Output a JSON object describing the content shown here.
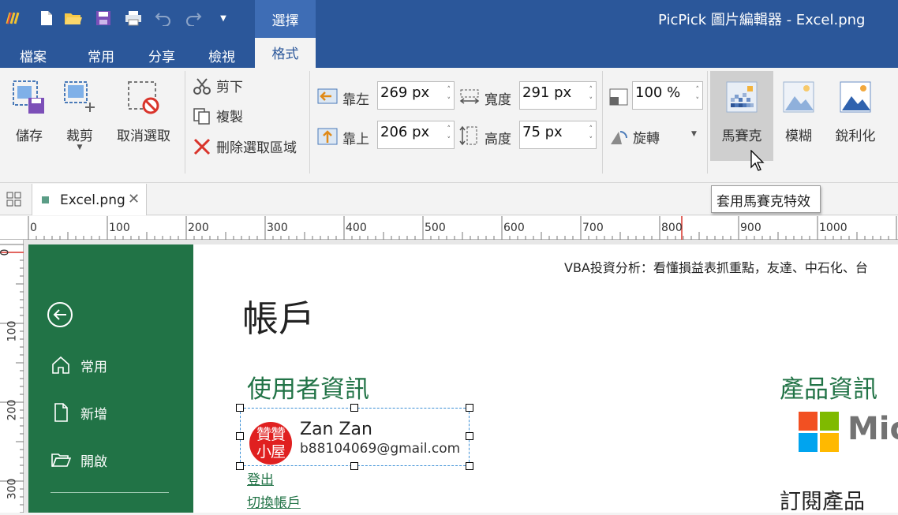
{
  "titlebar": {
    "app_title": "PicPick 圖片編輯器 - Excel.png",
    "context_tab": "選擇",
    "quick_access": [
      "logo-icon",
      "new-file-icon",
      "open-folder-icon",
      "save-icon",
      "print-icon",
      "undo-icon",
      "redo-icon",
      "customize-dropdown-icon"
    ]
  },
  "tabs": [
    {
      "label": "檔案"
    },
    {
      "label": "常用"
    },
    {
      "label": "分享"
    },
    {
      "label": "檢視"
    },
    {
      "label": "格式",
      "active": true
    }
  ],
  "ribbon": {
    "save": "儲存",
    "crop": "裁剪",
    "deselect": "取消選取",
    "cut": "剪下",
    "copy": "複製",
    "delete_selection": "刪除選取區域",
    "left_label": "靠左",
    "left_value": "269 px",
    "top_label": "靠上",
    "top_value": "206 px",
    "width_label": "寬度",
    "width_value": "291 px",
    "height_label": "高度",
    "height_value": "75 px",
    "zoom_value": "100 %",
    "rotate": "旋轉",
    "mosaic": "馬賽克",
    "blur": "模糊",
    "sharpen": "銳利化"
  },
  "tooltip": "套用馬賽克特效",
  "doc_tab": {
    "name": "Excel.png"
  },
  "ruler": {
    "h_ticks": [
      "0",
      "100",
      "200",
      "300",
      "400",
      "500",
      "600",
      "700",
      "800",
      "900",
      "1000"
    ],
    "v_ticks": [
      "0",
      "100",
      "200",
      "300"
    ]
  },
  "image": {
    "top_banner": "VBA投資分析：看懂損益表抓重點，友達、中石化、台",
    "page_title": "帳戶",
    "nav": [
      {
        "label": "常用",
        "icon": "home-icon"
      },
      {
        "label": "新增",
        "icon": "new-doc-icon"
      },
      {
        "label": "開啟",
        "icon": "folder-open-icon"
      }
    ],
    "user_info_heading": "使用者資訊",
    "user_name": "Zan Zan",
    "user_email": "b88104069@gmail.com",
    "avatar_text": "贊贊小屋",
    "sign_out": "登出",
    "switch_account": "切換帳戶",
    "product_info_heading": "產品資訊",
    "ms_logo_text": "Mic",
    "subscription_heading": "訂閱產品",
    "colors": {
      "excel_green": "#217346",
      "ribbon_blue": "#2b579a",
      "avatar_red": "#e02020"
    }
  }
}
